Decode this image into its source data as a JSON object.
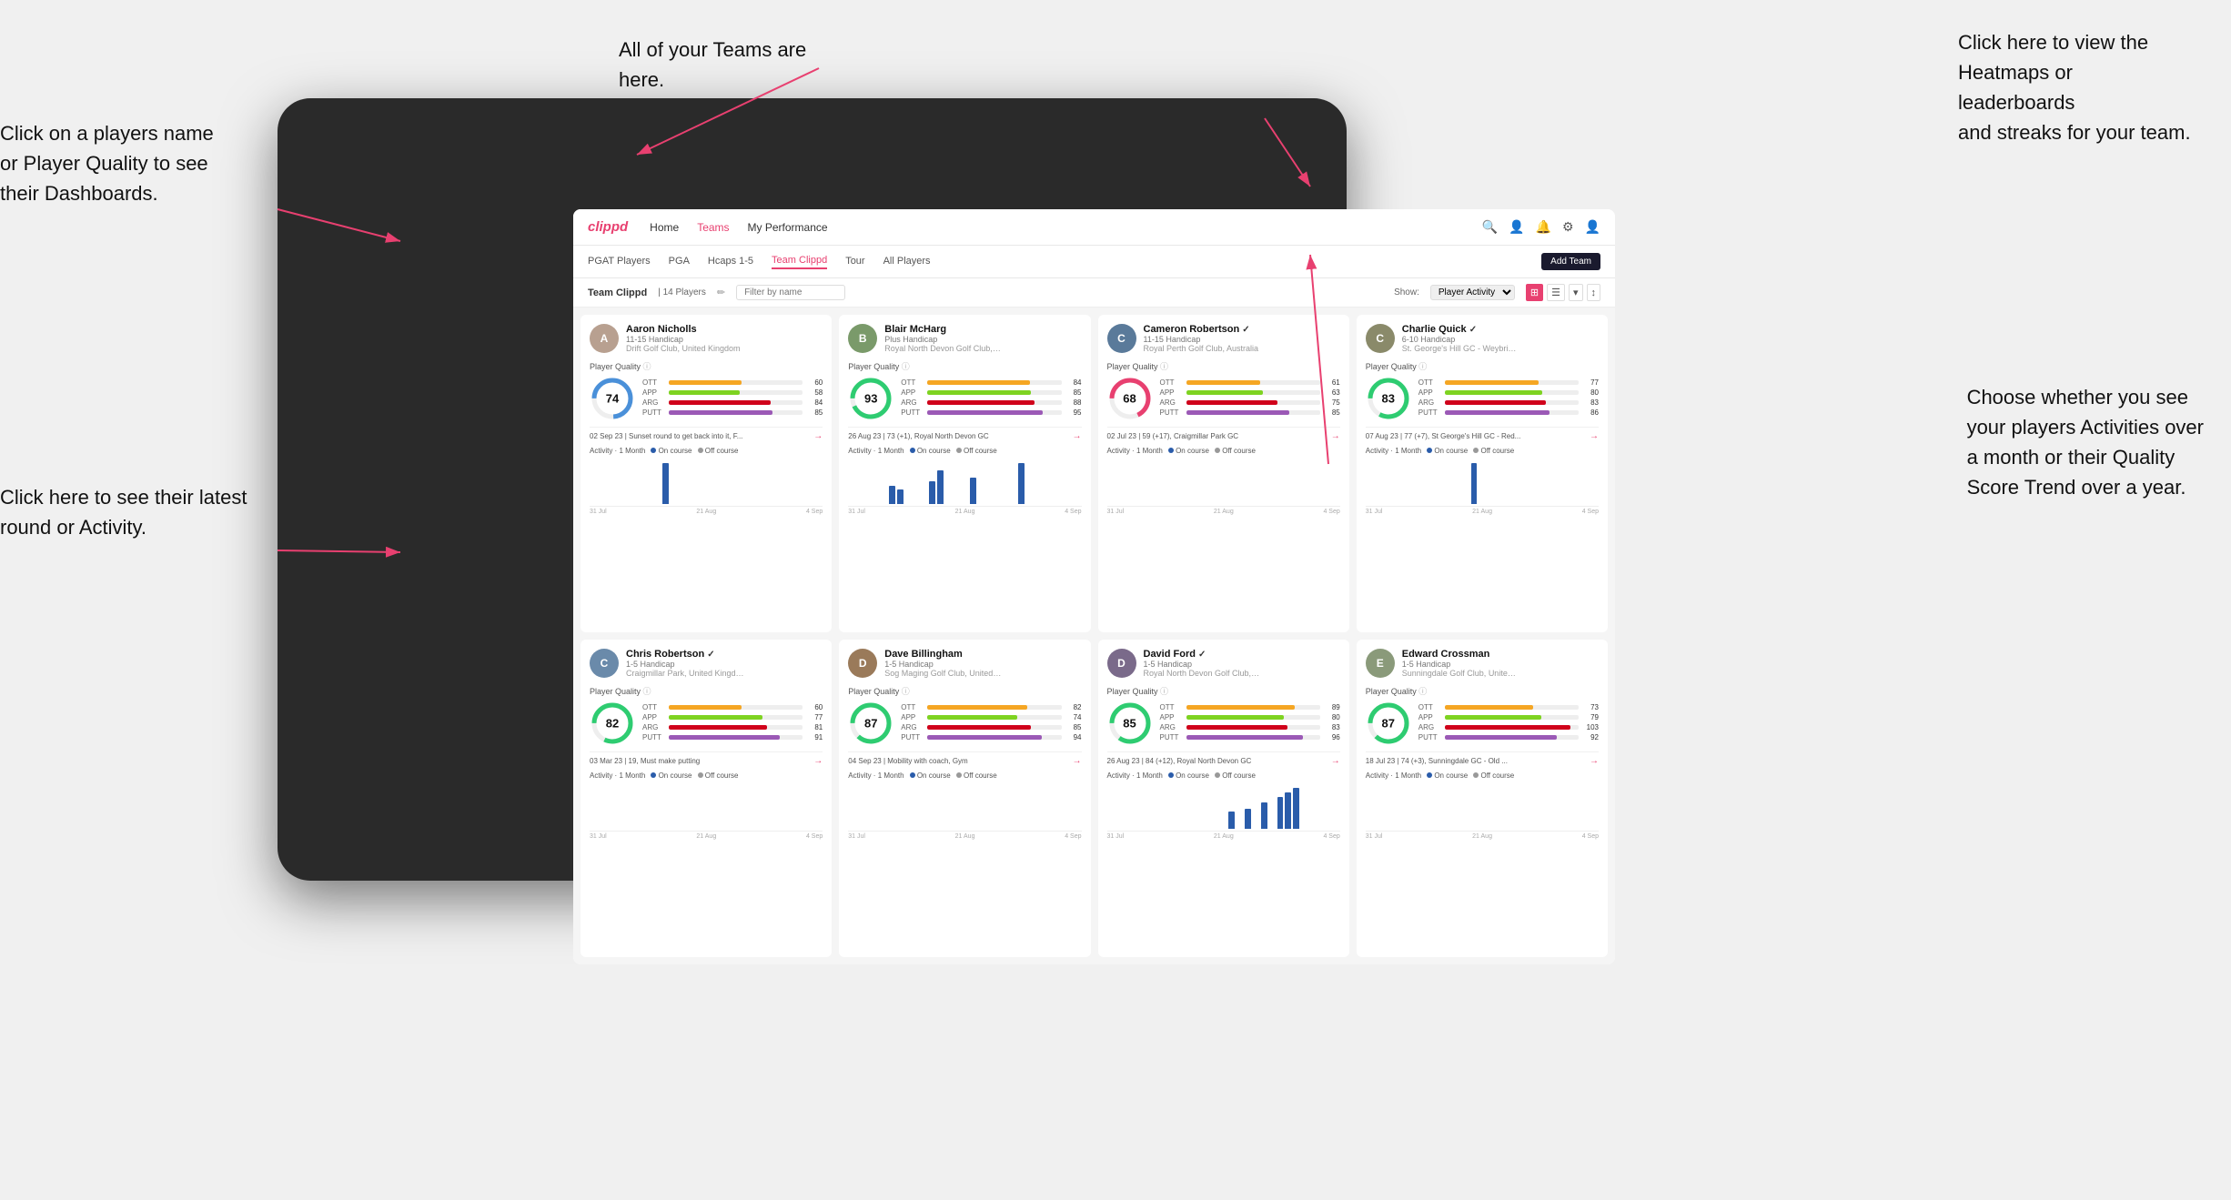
{
  "annotations": {
    "top_center": "All of your Teams are here.",
    "top_right": "Click here to view the\nHeatmaps or leaderboards\nand streaks for your team.",
    "left_top": "Click on a players name\nor Player Quality to see\ntheir Dashboards.",
    "left_bottom": "Click here to see their latest\nround or Activity.",
    "right_bottom": "Choose whether you see\nyour players Activities over\na month or their Quality\nScore Trend over a year."
  },
  "nav": {
    "logo": "clippd",
    "links": [
      "Home",
      "Teams",
      "My Performance"
    ],
    "active": "Teams"
  },
  "sub_nav": {
    "links": [
      "PGAT Players",
      "PGA",
      "Hcaps 1-5",
      "Team Clippd",
      "Tour",
      "All Players"
    ],
    "active": "Team Clippd",
    "add_btn": "Add Team"
  },
  "team_bar": {
    "label": "Team Clippd",
    "count": "14 Players",
    "search_placeholder": "Filter by name",
    "show_label": "Show:",
    "show_option": "Player Activity",
    "add_btn": "Add Team"
  },
  "players": [
    {
      "name": "Aaron Nicholls",
      "handicap": "11-15 Handicap",
      "club": "Drift Golf Club, United Kingdom",
      "quality": 74,
      "color": "#4a90d9",
      "avatar_color": "#b8a090",
      "stats": [
        {
          "name": "OTT",
          "value": 60,
          "color": "#f5a623"
        },
        {
          "name": "APP",
          "value": 58,
          "color": "#7ed321"
        },
        {
          "name": "ARG",
          "value": 84,
          "color": "#d0021b"
        },
        {
          "name": "PUTT",
          "value": 85,
          "color": "#9b59b6"
        }
      ],
      "latest": "02 Sep 23 | Sunset round to get back into it, F...",
      "activity_bars": [
        0,
        0,
        0,
        0,
        0,
        0,
        0,
        0,
        0,
        15,
        0,
        0,
        0,
        0,
        0,
        0,
        0,
        0,
        0,
        0,
        0,
        0,
        0,
        0,
        0,
        0,
        0,
        0,
        0
      ],
      "dates": [
        "31 Jul",
        "21 Aug",
        "4 Sep"
      ]
    },
    {
      "name": "Blair McHarg",
      "handicap": "Plus Handicap",
      "club": "Royal North Devon Golf Club, United Kin...",
      "quality": 93,
      "color": "#2ecc71",
      "avatar_color": "#7a9a6a",
      "stats": [
        {
          "name": "OTT",
          "value": 84,
          "color": "#f5a623"
        },
        {
          "name": "APP",
          "value": 85,
          "color": "#7ed321"
        },
        {
          "name": "ARG",
          "value": 88,
          "color": "#d0021b"
        },
        {
          "name": "PUTT",
          "value": 95,
          "color": "#9b59b6"
        }
      ],
      "latest": "26 Aug 23 | 73 (+1), Royal North Devon GC",
      "activity_bars": [
        0,
        0,
        0,
        0,
        0,
        10,
        8,
        0,
        0,
        0,
        12,
        18,
        0,
        0,
        0,
        14,
        0,
        0,
        0,
        0,
        0,
        22,
        0,
        0,
        0,
        0,
        0,
        0,
        0
      ],
      "dates": [
        "31 Jul",
        "21 Aug",
        "4 Sep"
      ]
    },
    {
      "name": "Cameron Robertson",
      "handicap": "11-15 Handicap",
      "club": "Royal Perth Golf Club, Australia",
      "quality": 68,
      "color": "#e84070",
      "avatar_color": "#5a7a9a",
      "verified": true,
      "stats": [
        {
          "name": "OTT",
          "value": 61,
          "color": "#f5a623"
        },
        {
          "name": "APP",
          "value": 63,
          "color": "#7ed321"
        },
        {
          "name": "ARG",
          "value": 75,
          "color": "#d0021b"
        },
        {
          "name": "PUTT",
          "value": 85,
          "color": "#9b59b6"
        }
      ],
      "latest": "02 Jul 23 | 59 (+17), Craigmillar Park GC",
      "activity_bars": [
        0,
        0,
        0,
        0,
        0,
        0,
        0,
        0,
        0,
        0,
        0,
        0,
        0,
        0,
        0,
        0,
        0,
        0,
        0,
        0,
        0,
        0,
        0,
        0,
        0,
        0,
        0,
        0,
        0
      ],
      "dates": [
        "31 Jul",
        "21 Aug",
        "4 Sep"
      ]
    },
    {
      "name": "Charlie Quick",
      "handicap": "6-10 Handicap",
      "club": "St. George's Hill GC - Weybridge - Surrey...",
      "quality": 83,
      "color": "#2ecc71",
      "avatar_color": "#8a8a6a",
      "verified": true,
      "stats": [
        {
          "name": "OTT",
          "value": 77,
          "color": "#f5a623"
        },
        {
          "name": "APP",
          "value": 80,
          "color": "#7ed321"
        },
        {
          "name": "ARG",
          "value": 83,
          "color": "#d0021b"
        },
        {
          "name": "PUTT",
          "value": 86,
          "color": "#9b59b6"
        }
      ],
      "latest": "07 Aug 23 | 77 (+7), St George's Hill GC - Red...",
      "activity_bars": [
        0,
        0,
        0,
        0,
        0,
        0,
        0,
        0,
        0,
        0,
        0,
        0,
        0,
        8,
        0,
        0,
        0,
        0,
        0,
        0,
        0,
        0,
        0,
        0,
        0,
        0,
        0,
        0,
        0
      ],
      "dates": [
        "31 Jul",
        "21 Aug",
        "4 Sep"
      ]
    },
    {
      "name": "Chris Robertson",
      "handicap": "1-5 Handicap",
      "club": "Craigmillar Park, United Kingdom",
      "quality": 82,
      "color": "#2ecc71",
      "avatar_color": "#6a8aaa",
      "verified": true,
      "stats": [
        {
          "name": "OTT",
          "value": 60,
          "color": "#f5a623"
        },
        {
          "name": "APP",
          "value": 77,
          "color": "#7ed321"
        },
        {
          "name": "ARG",
          "value": 81,
          "color": "#d0021b"
        },
        {
          "name": "PUTT",
          "value": 91,
          "color": "#9b59b6"
        }
      ],
      "latest": "03 Mar 23 | 19, Must make putting",
      "activity_bars": [
        0,
        0,
        0,
        0,
        0,
        0,
        0,
        0,
        0,
        0,
        0,
        0,
        0,
        0,
        0,
        0,
        0,
        0,
        0,
        0,
        0,
        0,
        0,
        0,
        0,
        0,
        0,
        0,
        0
      ],
      "dates": [
        "31 Jul",
        "21 Aug",
        "4 Sep"
      ]
    },
    {
      "name": "Dave Billingham",
      "handicap": "1-5 Handicap",
      "club": "Sog Maging Golf Club, United Kingdom",
      "quality": 87,
      "color": "#2ecc71",
      "avatar_color": "#9a7a5a",
      "stats": [
        {
          "name": "OTT",
          "value": 82,
          "color": "#f5a623"
        },
        {
          "name": "APP",
          "value": 74,
          "color": "#7ed321"
        },
        {
          "name": "ARG",
          "value": 85,
          "color": "#d0021b"
        },
        {
          "name": "PUTT",
          "value": 94,
          "color": "#9b59b6"
        }
      ],
      "latest": "04 Sep 23 | Mobility with coach, Gym",
      "activity_bars": [
        0,
        0,
        0,
        0,
        0,
        0,
        0,
        0,
        0,
        0,
        0,
        0,
        0,
        0,
        0,
        0,
        0,
        0,
        0,
        0,
        0,
        0,
        0,
        0,
        0,
        0,
        0,
        0,
        0
      ],
      "dates": [
        "31 Jul",
        "21 Aug",
        "4 Sep"
      ]
    },
    {
      "name": "David Ford",
      "handicap": "1-5 Handicap",
      "club": "Royal North Devon Golf Club, United Kil...",
      "quality": 85,
      "color": "#2ecc71",
      "avatar_color": "#7a6a8a",
      "verified": true,
      "stats": [
        {
          "name": "OTT",
          "value": 89,
          "color": "#f5a623"
        },
        {
          "name": "APP",
          "value": 80,
          "color": "#7ed321"
        },
        {
          "name": "ARG",
          "value": 83,
          "color": "#d0021b"
        },
        {
          "name": "PUTT",
          "value": 96,
          "color": "#9b59b6"
        }
      ],
      "latest": "26 Aug 23 | 84 (+12), Royal North Devon GC",
      "activity_bars": [
        0,
        0,
        0,
        0,
        0,
        0,
        0,
        0,
        0,
        0,
        0,
        0,
        0,
        0,
        0,
        12,
        0,
        14,
        0,
        18,
        0,
        22,
        25,
        28,
        0,
        0,
        0,
        0,
        0
      ],
      "dates": [
        "31 Jul",
        "21 Aug",
        "4 Sep"
      ]
    },
    {
      "name": "Edward Crossman",
      "handicap": "1-5 Handicap",
      "club": "Sunningdale Golf Club, United Kingdom",
      "quality": 87,
      "color": "#2ecc71",
      "avatar_color": "#8a9a7a",
      "stats": [
        {
          "name": "OTT",
          "value": 73,
          "color": "#f5a623"
        },
        {
          "name": "APP",
          "value": 79,
          "color": "#7ed321"
        },
        {
          "name": "ARG",
          "value": 103,
          "color": "#d0021b"
        },
        {
          "name": "PUTT",
          "value": 92,
          "color": "#9b59b6"
        }
      ],
      "latest": "18 Jul 23 | 74 (+3), Sunningdale GC - Old ...",
      "activity_bars": [
        0,
        0,
        0,
        0,
        0,
        0,
        0,
        0,
        0,
        0,
        0,
        0,
        0,
        0,
        0,
        0,
        0,
        0,
        0,
        0,
        0,
        0,
        0,
        0,
        0,
        0,
        0,
        0,
        0
      ],
      "dates": [
        "31 Jul",
        "21 Aug",
        "4 Sep"
      ]
    }
  ]
}
